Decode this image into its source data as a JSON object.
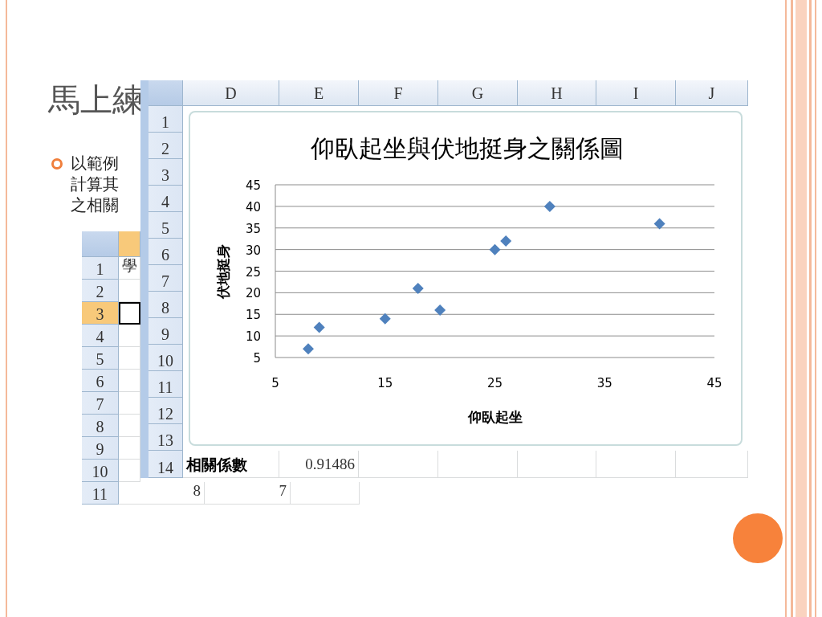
{
  "slide": {
    "title": "馬上練",
    "bullet_lines": [
      "以範例",
      "計算其",
      "之相關"
    ]
  },
  "back_sheet": {
    "active_column_header": {
      "selected": true
    },
    "rows": [
      {
        "number": "1",
        "selected": false,
        "cells": [
          "學"
        ]
      },
      {
        "number": "2",
        "selected": false,
        "cells": []
      },
      {
        "number": "3",
        "selected": true,
        "cells": []
      },
      {
        "number": "4",
        "selected": false,
        "cells": []
      },
      {
        "number": "5",
        "selected": false,
        "cells": []
      },
      {
        "number": "6",
        "selected": false,
        "cells": []
      },
      {
        "number": "7",
        "selected": false,
        "cells": []
      },
      {
        "number": "8",
        "selected": false,
        "cells": []
      },
      {
        "number": "9",
        "selected": false,
        "cells": []
      },
      {
        "number": "10",
        "selected": false,
        "cells": []
      },
      {
        "number": "11",
        "selected": false,
        "cells": [
          "8",
          "7"
        ]
      }
    ]
  },
  "front_sheet": {
    "columns": [
      "D",
      "E",
      "F",
      "G",
      "H",
      "I",
      "J"
    ],
    "rows": [
      {
        "number": "1",
        "cells": []
      },
      {
        "number": "2",
        "cells": []
      },
      {
        "number": "3",
        "cells": []
      },
      {
        "number": "4",
        "cells": []
      },
      {
        "number": "5",
        "cells": []
      },
      {
        "number": "6",
        "cells": []
      },
      {
        "number": "7",
        "cells": []
      },
      {
        "number": "8",
        "cells": []
      },
      {
        "number": "9",
        "cells": []
      },
      {
        "number": "10",
        "cells": []
      },
      {
        "number": "11",
        "cells": []
      },
      {
        "number": "12",
        "cells": []
      },
      {
        "number": "13",
        "cells": []
      },
      {
        "number": "14",
        "cells": [
          {
            "text": "相關係數",
            "kind": "label"
          },
          {
            "text": "0.91486",
            "kind": "number"
          }
        ]
      }
    ],
    "chart_data": {
      "type": "scatter",
      "title": "仰臥起坐與伏地挺身之關係圖",
      "xlabel": "仰臥起坐",
      "ylabel": "伏地挺身",
      "x": [
        8,
        9,
        15,
        18,
        20,
        25,
        26,
        30,
        40
      ],
      "grid": true,
      "series": [
        {
          "color": "#4f81bd",
          "values": [
            7,
            12,
            14,
            21,
            16,
            30,
            32,
            40,
            36
          ]
        }
      ],
      "xlim": [
        5,
        45
      ],
      "ylim": [
        5,
        45
      ],
      "xticks": [
        5,
        15,
        25,
        35,
        45
      ],
      "yticks": [
        5,
        10,
        15,
        20,
        25,
        30,
        35,
        40,
        45
      ]
    }
  }
}
